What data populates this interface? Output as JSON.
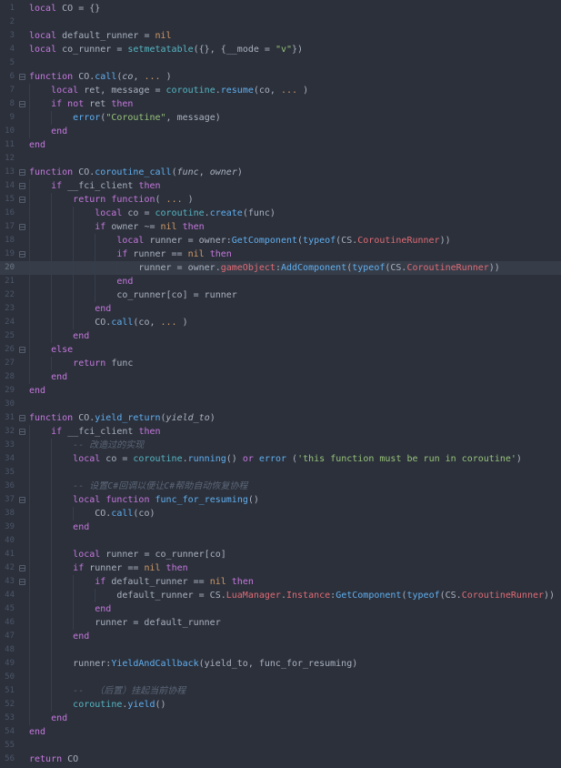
{
  "editor": {
    "language_hint": "lua",
    "current_line": 20,
    "fold_lines": [
      6,
      8,
      13,
      14,
      15,
      17,
      19,
      26,
      31,
      32,
      37,
      42,
      43
    ],
    "colors": {
      "background": "#2b303b",
      "current_line_bg": "#363d49",
      "line_number": "#4d5567",
      "indent_guide": "#373e4b",
      "keyword": "#c678dd",
      "default_text": "#abb2bf",
      "function_call": "#61afef",
      "builtin": "#56b6c2",
      "constant": "#d19a66",
      "string": "#98c379",
      "comment": "#5d6677",
      "property": "#e06c75"
    },
    "lines": [
      [
        [
          "kw",
          "local"
        ],
        [
          "txt",
          " CO = {}"
        ]
      ],
      [],
      [
        [
          "kw",
          "local"
        ],
        [
          "txt",
          " default_runner = "
        ],
        [
          "num",
          "nil"
        ]
      ],
      [
        [
          "kw",
          "local"
        ],
        [
          "txt",
          " co_runner = "
        ],
        [
          "bi",
          "setmetatable"
        ],
        [
          "txt",
          "({}, {__mode = "
        ],
        [
          "str",
          "\"v\""
        ],
        [
          "txt",
          "})"
        ]
      ],
      [],
      [
        [
          "kw",
          "function"
        ],
        [
          "txt",
          " CO."
        ],
        [
          "fn",
          "call"
        ],
        [
          "txt",
          "("
        ],
        [
          "par",
          "co"
        ],
        [
          "txt",
          ", "
        ],
        [
          "num",
          "..."
        ],
        [
          "txt",
          " )"
        ]
      ],
      [
        [
          "txt",
          "    "
        ],
        [
          "kw",
          "local"
        ],
        [
          "txt",
          " ret, message = "
        ],
        [
          "bi",
          "coroutine"
        ],
        [
          "txt",
          "."
        ],
        [
          "fn",
          "resume"
        ],
        [
          "txt",
          "(co, "
        ],
        [
          "num",
          "..."
        ],
        [
          "txt",
          " )"
        ]
      ],
      [
        [
          "txt",
          "    "
        ],
        [
          "kw",
          "if"
        ],
        [
          "txt",
          " "
        ],
        [
          "kw",
          "not"
        ],
        [
          "txt",
          " ret "
        ],
        [
          "kw",
          "then"
        ]
      ],
      [
        [
          "txt",
          "        "
        ],
        [
          "fn",
          "error"
        ],
        [
          "txt",
          "("
        ],
        [
          "str",
          "\"Coroutine\""
        ],
        [
          "txt",
          ", message)"
        ]
      ],
      [
        [
          "txt",
          "    "
        ],
        [
          "kw",
          "end"
        ]
      ],
      [
        [
          "kw",
          "end"
        ]
      ],
      [],
      [
        [
          "kw",
          "function"
        ],
        [
          "txt",
          " CO."
        ],
        [
          "fn",
          "coroutine_call"
        ],
        [
          "txt",
          "("
        ],
        [
          "par",
          "func"
        ],
        [
          "txt",
          ", "
        ],
        [
          "par",
          "owner"
        ],
        [
          "txt",
          ")"
        ]
      ],
      [
        [
          "txt",
          "    "
        ],
        [
          "kw",
          "if"
        ],
        [
          "txt",
          " __fci_client "
        ],
        [
          "kw",
          "then"
        ]
      ],
      [
        [
          "txt",
          "        "
        ],
        [
          "kw",
          "return"
        ],
        [
          "txt",
          " "
        ],
        [
          "kw",
          "function"
        ],
        [
          "txt",
          "( "
        ],
        [
          "num",
          "..."
        ],
        [
          "txt",
          " )"
        ]
      ],
      [
        [
          "txt",
          "            "
        ],
        [
          "kw",
          "local"
        ],
        [
          "txt",
          " co = "
        ],
        [
          "bi",
          "coroutine"
        ],
        [
          "txt",
          "."
        ],
        [
          "fn",
          "create"
        ],
        [
          "txt",
          "(func)"
        ]
      ],
      [
        [
          "txt",
          "            "
        ],
        [
          "kw",
          "if"
        ],
        [
          "txt",
          " owner ~= "
        ],
        [
          "num",
          "nil"
        ],
        [
          "txt",
          " "
        ],
        [
          "kw",
          "then"
        ]
      ],
      [
        [
          "txt",
          "                "
        ],
        [
          "kw",
          "local"
        ],
        [
          "txt",
          " runner = owner:"
        ],
        [
          "fn",
          "GetComponent"
        ],
        [
          "txt",
          "("
        ],
        [
          "fn",
          "typeof"
        ],
        [
          "txt",
          "(CS."
        ],
        [
          "prop",
          "CoroutineRunner"
        ],
        [
          "txt",
          "))"
        ]
      ],
      [
        [
          "txt",
          "                "
        ],
        [
          "kw",
          "if"
        ],
        [
          "txt",
          " runner == "
        ],
        [
          "num",
          "nil"
        ],
        [
          "txt",
          " "
        ],
        [
          "kw",
          "then"
        ]
      ],
      [
        [
          "txt",
          "                    runner = owner."
        ],
        [
          "prop",
          "gameObject"
        ],
        [
          "txt",
          ":"
        ],
        [
          "fn",
          "AddComponent"
        ],
        [
          "txt",
          "("
        ],
        [
          "fn",
          "typeof"
        ],
        [
          "txt",
          "(CS."
        ],
        [
          "prop",
          "CoroutineRunner"
        ],
        [
          "txt",
          "))"
        ]
      ],
      [
        [
          "txt",
          "                "
        ],
        [
          "kw",
          "end"
        ]
      ],
      [
        [
          "txt",
          "                co_runner[co] = runner"
        ]
      ],
      [
        [
          "txt",
          "            "
        ],
        [
          "kw",
          "end"
        ]
      ],
      [
        [
          "txt",
          "            CO."
        ],
        [
          "fn",
          "call"
        ],
        [
          "txt",
          "(co, "
        ],
        [
          "num",
          "..."
        ],
        [
          "txt",
          " )"
        ]
      ],
      [
        [
          "txt",
          "        "
        ],
        [
          "kw",
          "end"
        ]
      ],
      [
        [
          "txt",
          "    "
        ],
        [
          "kw",
          "else"
        ]
      ],
      [
        [
          "txt",
          "        "
        ],
        [
          "kw",
          "return"
        ],
        [
          "txt",
          " func"
        ]
      ],
      [
        [
          "txt",
          "    "
        ],
        [
          "kw",
          "end"
        ]
      ],
      [
        [
          "kw",
          "end"
        ]
      ],
      [],
      [
        [
          "kw",
          "function"
        ],
        [
          "txt",
          " CO."
        ],
        [
          "fn",
          "yield_return"
        ],
        [
          "txt",
          "("
        ],
        [
          "par",
          "yield_to"
        ],
        [
          "txt",
          ")"
        ]
      ],
      [
        [
          "txt",
          "    "
        ],
        [
          "kw",
          "if"
        ],
        [
          "txt",
          " __fci_client "
        ],
        [
          "kw",
          "then"
        ]
      ],
      [
        [
          "txt",
          "        "
        ],
        [
          "cmt",
          "-- 改造过的实现"
        ]
      ],
      [
        [
          "txt",
          "        "
        ],
        [
          "kw",
          "local"
        ],
        [
          "txt",
          " co = "
        ],
        [
          "bi",
          "coroutine"
        ],
        [
          "txt",
          "."
        ],
        [
          "fn",
          "running"
        ],
        [
          "txt",
          "() "
        ],
        [
          "kw",
          "or"
        ],
        [
          "txt",
          " "
        ],
        [
          "fn",
          "error"
        ],
        [
          "txt",
          " ("
        ],
        [
          "str",
          "'this function must be run in coroutine'"
        ],
        [
          "txt",
          ")"
        ]
      ],
      [],
      [
        [
          "txt",
          "        "
        ],
        [
          "cmt",
          "-- 设置C#回调以便让C#帮助自动恢复协程"
        ]
      ],
      [
        [
          "txt",
          "        "
        ],
        [
          "kw",
          "local"
        ],
        [
          "txt",
          " "
        ],
        [
          "kw",
          "function"
        ],
        [
          "txt",
          " "
        ],
        [
          "fn",
          "func_for_resuming"
        ],
        [
          "txt",
          "()"
        ]
      ],
      [
        [
          "txt",
          "            CO."
        ],
        [
          "fn",
          "call"
        ],
        [
          "txt",
          "(co)"
        ]
      ],
      [
        [
          "txt",
          "        "
        ],
        [
          "kw",
          "end"
        ]
      ],
      [],
      [
        [
          "txt",
          "        "
        ],
        [
          "kw",
          "local"
        ],
        [
          "txt",
          " runner = co_runner[co]"
        ]
      ],
      [
        [
          "txt",
          "        "
        ],
        [
          "kw",
          "if"
        ],
        [
          "txt",
          " runner == "
        ],
        [
          "num",
          "nil"
        ],
        [
          "txt",
          " "
        ],
        [
          "kw",
          "then"
        ]
      ],
      [
        [
          "txt",
          "            "
        ],
        [
          "kw",
          "if"
        ],
        [
          "txt",
          " default_runner == "
        ],
        [
          "num",
          "nil"
        ],
        [
          "txt",
          " "
        ],
        [
          "kw",
          "then"
        ]
      ],
      [
        [
          "txt",
          "                default_runner = CS."
        ],
        [
          "prop",
          "LuaManager"
        ],
        [
          "txt",
          "."
        ],
        [
          "prop",
          "Instance"
        ],
        [
          "txt",
          ":"
        ],
        [
          "fn",
          "GetComponent"
        ],
        [
          "txt",
          "("
        ],
        [
          "fn",
          "typeof"
        ],
        [
          "txt",
          "(CS."
        ],
        [
          "prop",
          "CoroutineRunner"
        ],
        [
          "txt",
          "))"
        ]
      ],
      [
        [
          "txt",
          "            "
        ],
        [
          "kw",
          "end"
        ]
      ],
      [
        [
          "txt",
          "            runner = default_runner"
        ]
      ],
      [
        [
          "txt",
          "        "
        ],
        [
          "kw",
          "end"
        ]
      ],
      [],
      [
        [
          "txt",
          "        runner:"
        ],
        [
          "fn",
          "YieldAndCallback"
        ],
        [
          "txt",
          "(yield_to, func_for_resuming)"
        ]
      ],
      [],
      [
        [
          "txt",
          "        "
        ],
        [
          "cmt",
          "--  （后置）挂起当前协程"
        ]
      ],
      [
        [
          "txt",
          "        "
        ],
        [
          "bi",
          "coroutine"
        ],
        [
          "txt",
          "."
        ],
        [
          "fn",
          "yield"
        ],
        [
          "txt",
          "()"
        ]
      ],
      [
        [
          "txt",
          "    "
        ],
        [
          "kw",
          "end"
        ]
      ],
      [
        [
          "kw",
          "end"
        ]
      ],
      [],
      [
        [
          "kw",
          "return"
        ],
        [
          "txt",
          " CO"
        ]
      ]
    ]
  }
}
